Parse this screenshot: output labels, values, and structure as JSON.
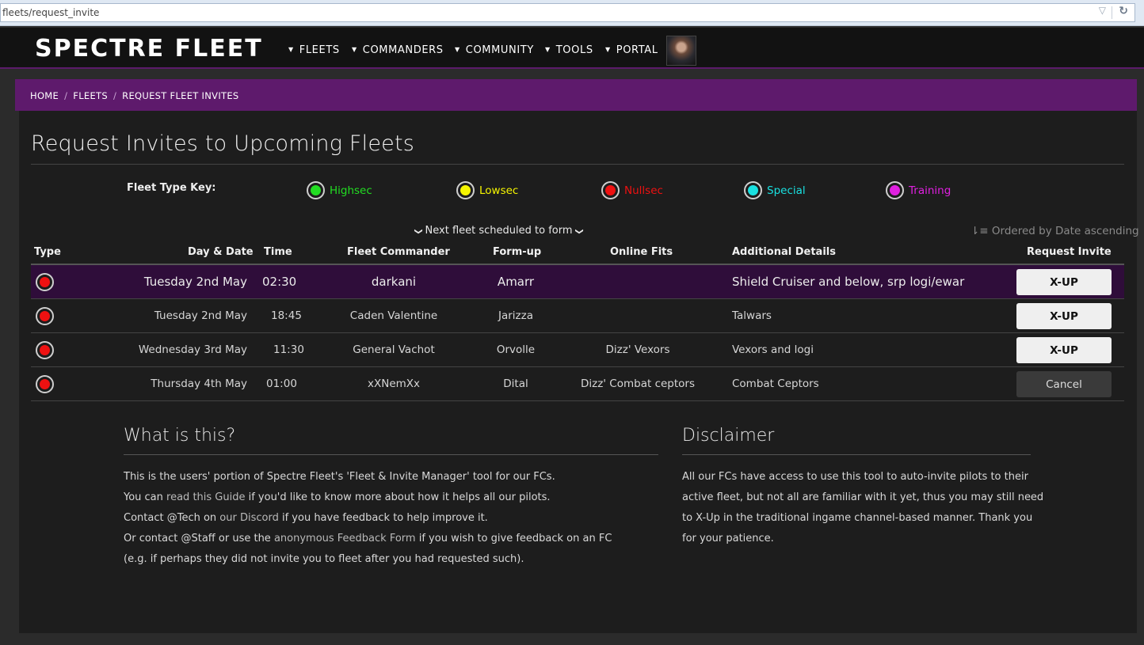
{
  "browser": {
    "url": "fleets/request_invite",
    "dropdown_icon": "chevron-down-icon",
    "reload_icon": "reload-icon"
  },
  "nav": {
    "logo": "SPECTRE FLEET",
    "items": [
      {
        "label": "FLEETS"
      },
      {
        "label": "COMMANDERS"
      },
      {
        "label": "COMMUNITY"
      },
      {
        "label": "TOOLS"
      },
      {
        "label": "PORTAL"
      }
    ],
    "avatar": "user-portrait"
  },
  "breadcrumb": {
    "items": [
      "HOME",
      "FLEETS",
      "REQUEST FLEET INVITES"
    ],
    "separator": "/"
  },
  "page": {
    "title": "Request Invites to Upcoming Fleets"
  },
  "fleet_key": {
    "label": "Fleet Type Key:",
    "types": [
      {
        "label": "Highsec",
        "color": "#22dd22"
      },
      {
        "label": "Lowsec",
        "color": "#f5f500"
      },
      {
        "label": "Nullsec",
        "color": "#ee1111"
      },
      {
        "label": "Special",
        "color": "#19e0e0"
      },
      {
        "label": "Training",
        "color": "#e020e0"
      }
    ]
  },
  "schedule": {
    "next_label": "Next fleet scheduled to form",
    "ordered_label": "Ordered by Date ascending"
  },
  "table": {
    "headers": {
      "type": "Type",
      "date": "Day & Date",
      "time": "Time",
      "fc": "Fleet Commander",
      "formup": "Form-up",
      "fits": "Online Fits",
      "details": "Additional Details",
      "invite": "Request Invite"
    },
    "rows": [
      {
        "type_color": "#ee1111",
        "date": "Tuesday 2nd May",
        "time": "02:30",
        "fc": "darkani",
        "formup": "Amarr",
        "fits": "",
        "details": "Shield Cruiser and below, srp logi/ewar",
        "action": "X-UP"
      },
      {
        "type_color": "#ee1111",
        "date": "Tuesday 2nd May",
        "time": "18:45",
        "fc": "Caden Valentine",
        "formup": "Jarizza",
        "fits": "",
        "details": "Talwars",
        "action": "X-UP"
      },
      {
        "type_color": "#ee1111",
        "date": "Wednesday 3rd May",
        "time": "11:30",
        "fc": "General Vachot",
        "formup": "Orvolle",
        "fits": "Dizz' Vexors",
        "details": "Vexors and logi",
        "action": "X-UP"
      },
      {
        "type_color": "#ee1111",
        "date": "Thursday 4th May",
        "time": "01:00",
        "fc": "xXNemXx",
        "formup": "Dital",
        "fits": "Dizz' Combat ceptors",
        "details": "Combat Ceptors",
        "action": "Cancel"
      }
    ]
  },
  "what_is_this": {
    "title": "What is this?",
    "line1": "This is the users' portion of Spectre Fleet's 'Fleet & Invite Manager' tool for our FCs.",
    "line2_pre": "You can ",
    "line2_link": "read this Guide",
    "line2_post": " if you'd like to know more about how it helps all our pilots.",
    "line3_pre": "Contact @Tech on ",
    "line3_link": "our Discord",
    "line3_post": " if you have feedback to help improve it.",
    "line4_pre": "Or contact @Staff or use the ",
    "line4_link": "anonymous Feedback Form",
    "line4_post": " if you wish to give feedback on an FC",
    "line5": "(e.g. if perhaps they did not invite you to fleet after you had requested such)."
  },
  "disclaimer": {
    "title": "Disclaimer",
    "lines": [
      "All our FCs have access to use this tool to auto-invite pilots to their",
      "active fleet, but not all are familiar with it yet, thus you may still need",
      "to X-Up in the traditional ingame channel-based manner. Thank you",
      "for your patience."
    ]
  }
}
